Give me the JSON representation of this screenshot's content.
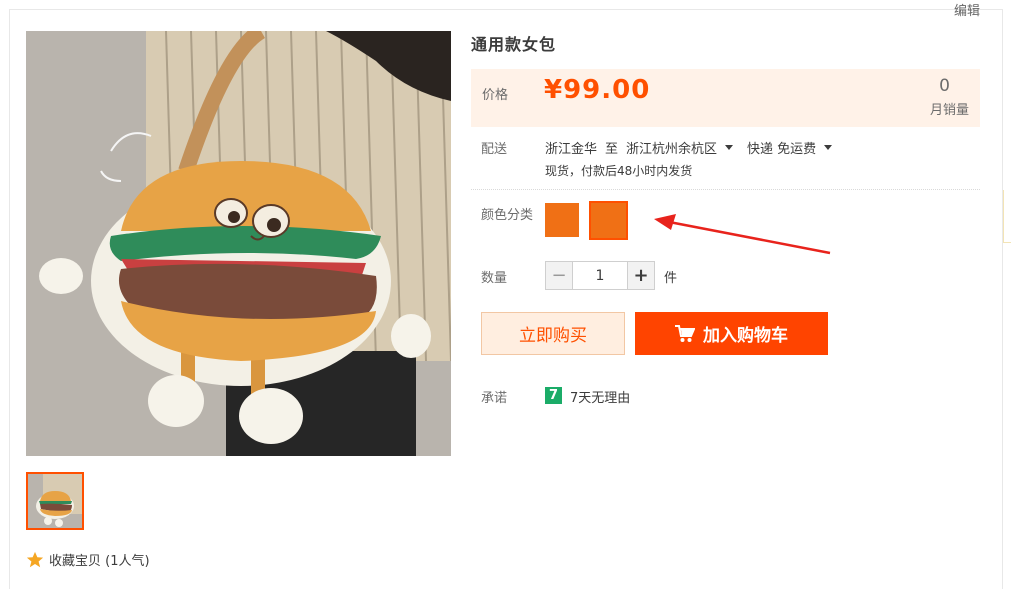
{
  "header": {
    "edit_label": "编辑"
  },
  "gallery": {
    "main_image_icon": "burger-bag-photo",
    "thumbnail_icon": "burger-bag-thumbnail"
  },
  "favorite": {
    "icon": "star-icon",
    "label": "收藏宝贝 (1人气)"
  },
  "product": {
    "title": "通用款女包",
    "price_label": "价格",
    "price": "¥99.00",
    "monthly_sales": "0",
    "monthly_sales_label": "月销量"
  },
  "delivery": {
    "label": "配送",
    "origin": "浙江金华",
    "to": "至",
    "destination": "浙江杭州余杭区",
    "method": "快递 免运费",
    "note": "现货，付款后48小时内发货"
  },
  "color": {
    "label": "颜色分类",
    "options": [
      {
        "swatch_color": "#f07015",
        "selected": false
      },
      {
        "swatch_color": "#f07015",
        "selected": true
      }
    ],
    "annotation": "red-arrow"
  },
  "quantity": {
    "label": "数量",
    "value": "1",
    "unit": "件",
    "minus": "−",
    "plus": "+"
  },
  "actions": {
    "buy_now": "立即购买",
    "add_to_cart": "加入购物车"
  },
  "promise": {
    "label": "承诺",
    "badge": "7",
    "text": "7天无理由"
  },
  "colors": {
    "accent": "#ff5000",
    "cart_button": "#ff4400",
    "price_bg": "#fff2e8",
    "promise_green": "#1bac68"
  }
}
